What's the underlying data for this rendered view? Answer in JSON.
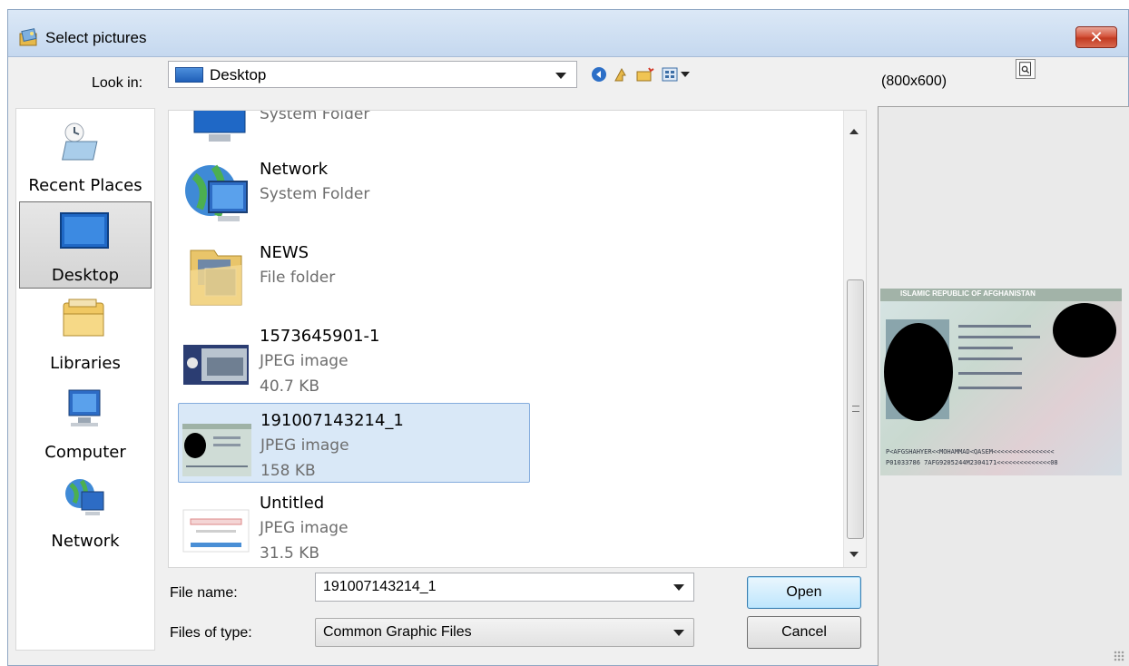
{
  "window": {
    "title": "Select pictures",
    "close_label": "✕"
  },
  "toolbar": {
    "lookin_label": "Look in:",
    "lookin_value": "Desktop"
  },
  "places": [
    {
      "label": "Recent Places",
      "icon": "recent-places-icon"
    },
    {
      "label": "Desktop",
      "icon": "desktop-icon"
    },
    {
      "label": "Libraries",
      "icon": "libraries-icon"
    },
    {
      "label": "Computer",
      "icon": "computer-icon"
    },
    {
      "label": "Network",
      "icon": "network-icon"
    }
  ],
  "files": [
    {
      "name": "",
      "type": "System Folder",
      "size": ""
    },
    {
      "name": "Network",
      "type": "System Folder",
      "size": ""
    },
    {
      "name": "NEWS",
      "type": "File folder",
      "size": ""
    },
    {
      "name": "1573645901-1",
      "type": "JPEG image",
      "size": "40.7 KB"
    },
    {
      "name": "191007143214_1",
      "type": "JPEG image",
      "size": "158 KB",
      "selected": true
    },
    {
      "name": "Untitled",
      "type": "JPEG image",
      "size": "31.5 KB"
    }
  ],
  "form": {
    "filename_label": "File name:",
    "filename_value": "191007143214_1",
    "filetype_label": "Files of type:",
    "filetype_value": "Common Graphic Files",
    "open_label": "Open",
    "cancel_label": "Cancel"
  },
  "preview": {
    "size_label": "(800x600)",
    "passport_header": "ISLAMIC REPUBLIC OF AFGHANISTAN",
    "mrz1": "P<AFGSHAHYER<<MOHAMMAD<QASEM<<<<<<<<<<<<<<<<",
    "mrz2": "P01033786 7AFG9205244M2304171<<<<<<<<<<<<<<08"
  },
  "colors": {
    "selection": "#d9e8f7",
    "selection_border": "#84acdd",
    "title_bg": "#c5d8ef",
    "close_red": "#c23b22"
  }
}
